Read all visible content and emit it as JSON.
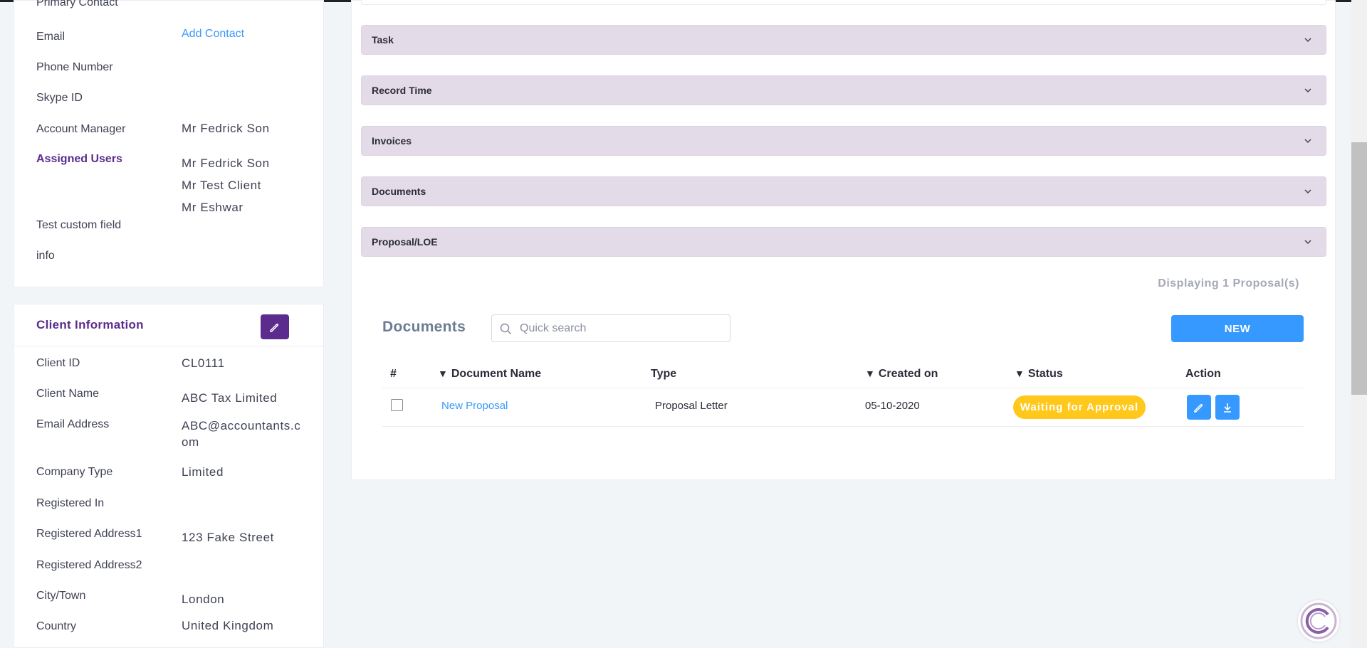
{
  "contact_card": {
    "primary_contact_label": "Primary Contact",
    "email_label": "Email",
    "email_value": "Add Contact",
    "phone_label": "Phone Number",
    "skype_label": "Skype ID",
    "account_manager_label": "Account Manager",
    "account_manager_value": "Mr Fedrick Son",
    "assigned_users_label": "Assigned Users",
    "assigned_users": [
      "Mr Fedrick Son",
      "Mr Test Client",
      "Mr Eshwar"
    ],
    "custom_field_label": "Test custom field",
    "info_label": "info"
  },
  "client_info": {
    "title": "Client Information",
    "fields": [
      {
        "label": "Client ID",
        "value": "CL0111"
      },
      {
        "label": "Client Name",
        "value": "ABC Tax Limited"
      },
      {
        "label": "Email Address",
        "value": "ABC@accountants.c\nom"
      },
      {
        "label": "Company Type",
        "value": "Limited"
      },
      {
        "label": "Registered In",
        "value": ""
      },
      {
        "label": "Registered Address1",
        "value": "123 Fake Street"
      },
      {
        "label": "Registered Address2",
        "value": ""
      },
      {
        "label": "City/Town",
        "value": "London"
      },
      {
        "label": "Country",
        "value": "United Kingdom"
      }
    ]
  },
  "accordions": [
    "Task",
    "Record Time",
    "Invoices",
    "Documents",
    "Proposal/LOE"
  ],
  "proposals": {
    "displaying": "Displaying 1 Proposal(s)",
    "section_title": "Documents",
    "search_placeholder": "Quick search",
    "new_button": "NEW",
    "columns": [
      "#",
      "Document Name",
      "Type",
      "Created on",
      "Status",
      "Action"
    ],
    "rows": [
      {
        "name": "New Proposal",
        "type": "Proposal Letter",
        "created_on": "05-10-2020",
        "status": "Waiting for Approval"
      }
    ]
  },
  "colors": {
    "accent": "#3699ff",
    "brand_purple": "#5b2c8d",
    "accordion_bg": "#e4dbe8",
    "status_waiting": "#ffc81a"
  }
}
